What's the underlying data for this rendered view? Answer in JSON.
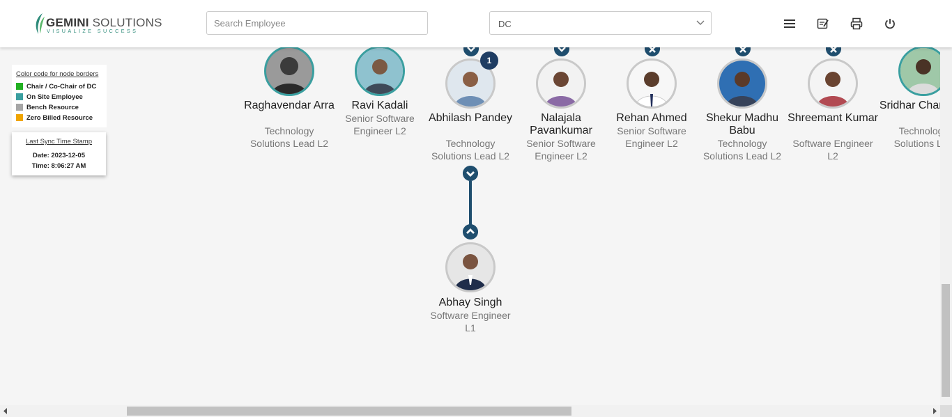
{
  "header": {
    "logo": {
      "brand_bold": "GEMINI",
      "brand_rest": " SOLUTIONS",
      "tagline": "VISUALIZE SUCCESS"
    },
    "search": {
      "placeholder": "Search Employee",
      "value": ""
    },
    "dropdown": {
      "selected": "DC"
    },
    "icons": [
      "menu-icon",
      "notes-icon",
      "print-icon",
      "power-icon"
    ]
  },
  "legend": {
    "title": "Color code for node borders",
    "items": [
      {
        "label": "Chair / Co-Chair of DC",
        "color": "#22b022"
      },
      {
        "label": "On Site Employee",
        "color": "#3a9fa0"
      },
      {
        "label": "Bench Resource",
        "color": "#a6a6a6"
      },
      {
        "label": "Zero Billed Resource",
        "color": "#f0a500"
      }
    ]
  },
  "sync": {
    "title": "Last Sync Time Stamp",
    "date": "Date: 2023-12-05",
    "time": "Time: 8:06:27 AM"
  },
  "nodes": [
    {
      "name": "Raghavendar Arra",
      "role": "Technology Solutions Lead L2",
      "border": "onsite"
    },
    {
      "name": "Ravi Kadali",
      "role": "Senior Software Engineer L2",
      "border": "onsite"
    },
    {
      "name": "Abhilash Pandey",
      "role": "Technology Solutions Lead L2",
      "border": "default",
      "badge": "1"
    },
    {
      "name": "Nalajala Pavankumar",
      "role": "Senior Software Engineer L2",
      "border": "default"
    },
    {
      "name": "Rehan Ahmed",
      "role": "Senior Software Engineer L2",
      "border": "default"
    },
    {
      "name": "Shekur Madhu Babu",
      "role": "Technology Solutions Lead L2",
      "border": "default"
    },
    {
      "name": "Shreemant Kumar",
      "role": "Software Engineer L2",
      "border": "default"
    },
    {
      "name": "Sridhar Chandrag",
      "role": "Technology Solutions Lea",
      "border": "onsite"
    }
  ],
  "child": {
    "name": "Abhay Singh",
    "role": "Software Engineer L1",
    "border": "default"
  },
  "colors": {
    "accent": "#1f4e6e",
    "badge": "#1f3d63"
  }
}
